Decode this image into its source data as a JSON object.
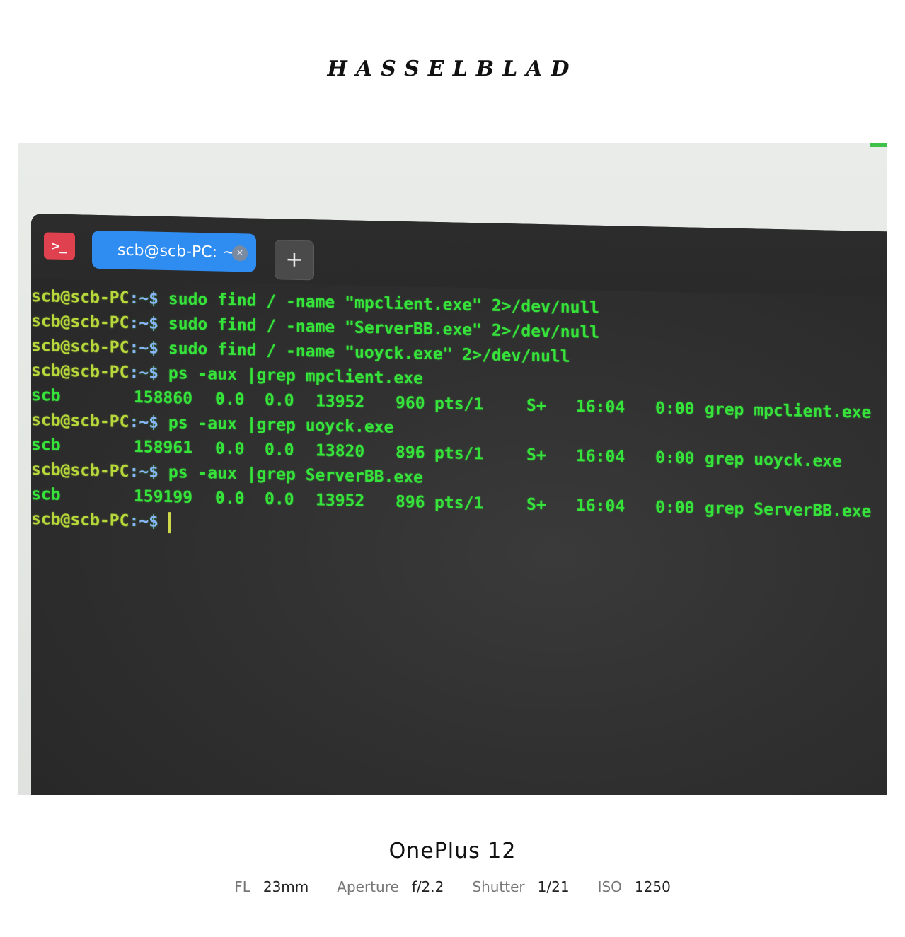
{
  "brand": "HASSELBLAD",
  "terminal": {
    "tab_title": "scb@scb-PC: ~",
    "icon_glyph": ">_",
    "newtab_glyph": "+",
    "close_glyph": "×",
    "prompt_user": "scb@scb-PC",
    "prompt_sep": ":~$",
    "lines": [
      {
        "type": "cmd",
        "text": " sudo find / -name \"mpclient.exe\" 2>/dev/null"
      },
      {
        "type": "cmd",
        "text": " sudo find / -name \"ServerBB.exe\" 2>/dev/null"
      },
      {
        "type": "cmd",
        "text": " sudo find / -name \"uoyck.exe\" 2>/dev/null"
      },
      {
        "type": "cmd",
        "text": " ps -aux |grep mpclient.exe"
      },
      {
        "type": "out",
        "user": "scb",
        "pid": "158860",
        "cpu": "0.0",
        "mem": "0.0",
        "vsz": "13952",
        "rss": "960",
        "tty": "pts/1",
        "stat": "S+",
        "start": "16:04",
        "time": "0:00",
        "cmd": "grep mpclient.exe"
      },
      {
        "type": "cmd",
        "text": " ps -aux |grep uoyck.exe"
      },
      {
        "type": "out",
        "user": "scb",
        "pid": "158961",
        "cpu": "0.0",
        "mem": "0.0",
        "vsz": "13820",
        "rss": "896",
        "tty": "pts/1",
        "stat": "S+",
        "start": "16:04",
        "time": "0:00",
        "cmd": "grep uoyck.exe"
      },
      {
        "type": "cmd",
        "text": " ps -aux |grep ServerBB.exe"
      },
      {
        "type": "out",
        "user": "scb",
        "pid": "159199",
        "cpu": "0.0",
        "mem": "0.0",
        "vsz": "13952",
        "rss": "896",
        "tty": "pts/1",
        "stat": "S+",
        "start": "16:04",
        "time": "0:00",
        "cmd": "grep ServerBB.exe"
      },
      {
        "type": "prompt",
        "text": ""
      }
    ]
  },
  "camera": {
    "device": "OnePlus 12",
    "fl_label": "FL",
    "fl_value": "23mm",
    "aperture_label": "Aperture",
    "aperture_value": "f/2.2",
    "shutter_label": "Shutter",
    "shutter_value": "1/21",
    "iso_label": "ISO",
    "iso_value": "1250"
  },
  "colors": {
    "terminal_text": "#36e33a",
    "prompt_user": "#b6d83a",
    "tab_active": "#2f8cf0",
    "app_icon": "#e0414e"
  }
}
